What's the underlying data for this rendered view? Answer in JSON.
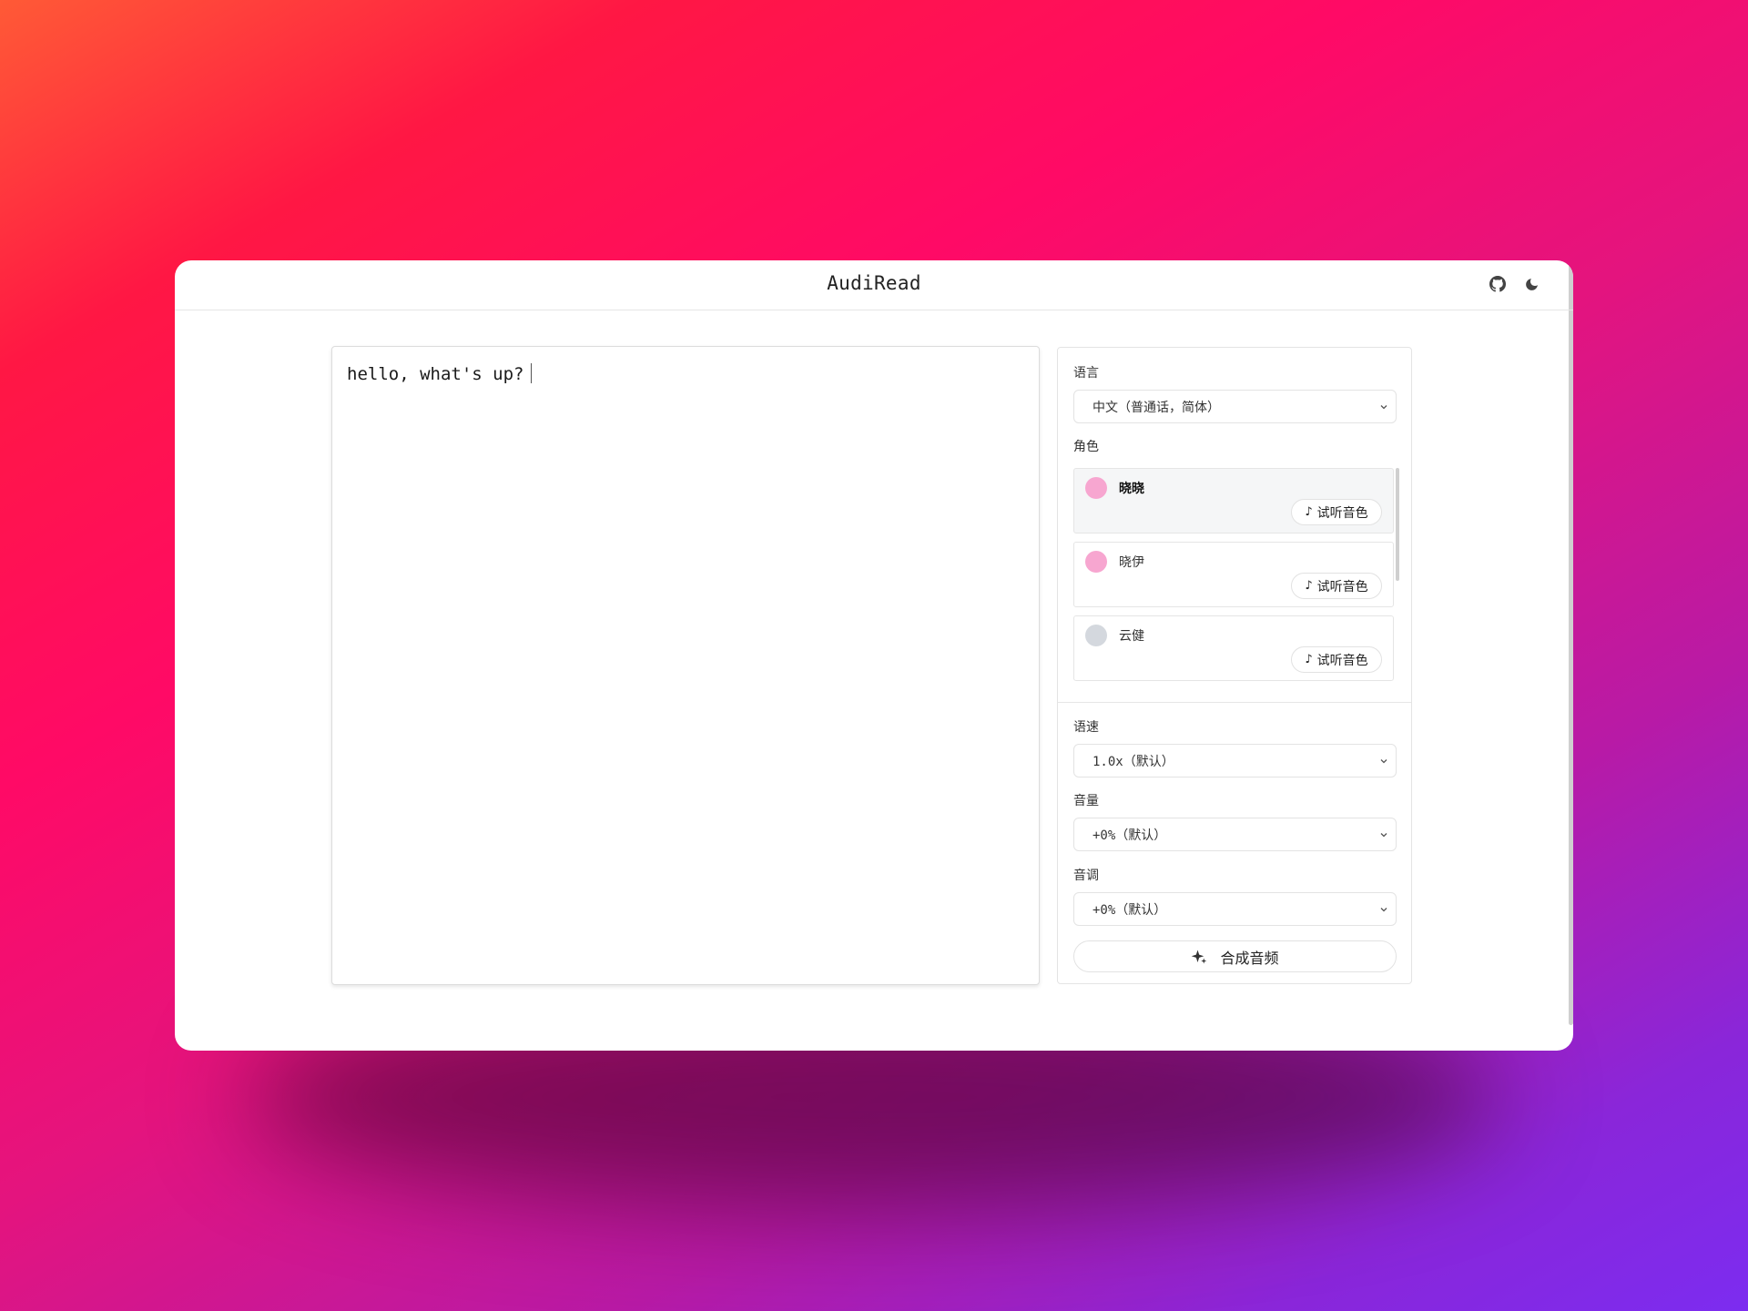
{
  "header": {
    "title": "AudiRead",
    "github_icon": "github-icon",
    "theme_icon": "moon-icon"
  },
  "editor": {
    "text": "hello, what's up?"
  },
  "settings": {
    "language": {
      "label": "语言",
      "value": "中文（普通话，简体）"
    },
    "role": {
      "label": "角色",
      "items": [
        {
          "name": "晓晓",
          "avatar_color": "#f7a6d0",
          "preview_label": "试听音色",
          "selected": true
        },
        {
          "name": "晓伊",
          "avatar_color": "#f7a6d0",
          "preview_label": "试听音色",
          "selected": false
        },
        {
          "name": "云健",
          "avatar_color": "#d4d8de",
          "preview_label": "试听音色",
          "selected": false
        }
      ]
    },
    "rate": {
      "label": "语速",
      "value": "1.0x（默认）"
    },
    "volume": {
      "label": "音量",
      "value": "+0%（默认）"
    },
    "pitch": {
      "label": "音调",
      "value": "+0%（默认）"
    },
    "synthesize_label": "合成音频"
  },
  "colors": {
    "accent_pink": "#f7a6d0",
    "avatar_gray": "#d4d8de"
  }
}
